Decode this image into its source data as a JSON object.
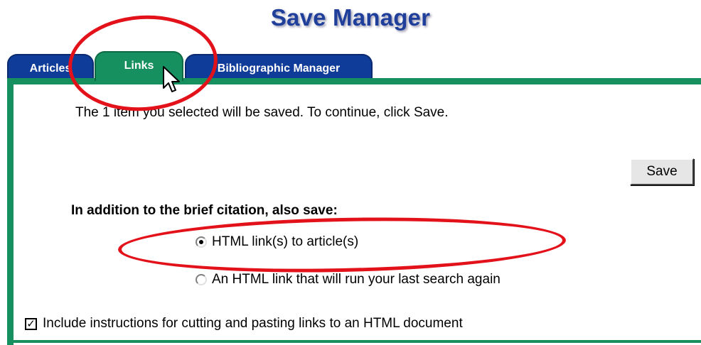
{
  "title": "Save Manager",
  "tabs": {
    "articles": "Articles",
    "links": "Links",
    "biblio": "Bibliographic Manager"
  },
  "info_text": "The 1 item you selected will be saved. To continue, click Save.",
  "save_label": "Save",
  "also_label": "In addition to the brief citation, also save:",
  "radio_options": {
    "opt1": "HTML link(s) to article(s)",
    "opt2": "An HTML link that will run your last search again"
  },
  "checkbox_label": "Include instructions for cutting and pasting links to an HTML document",
  "colors": {
    "tab_blue": "#103c99",
    "tab_green": "#16905f",
    "title_blue": "#1f3f9a",
    "annotation_red": "#e3121a"
  }
}
